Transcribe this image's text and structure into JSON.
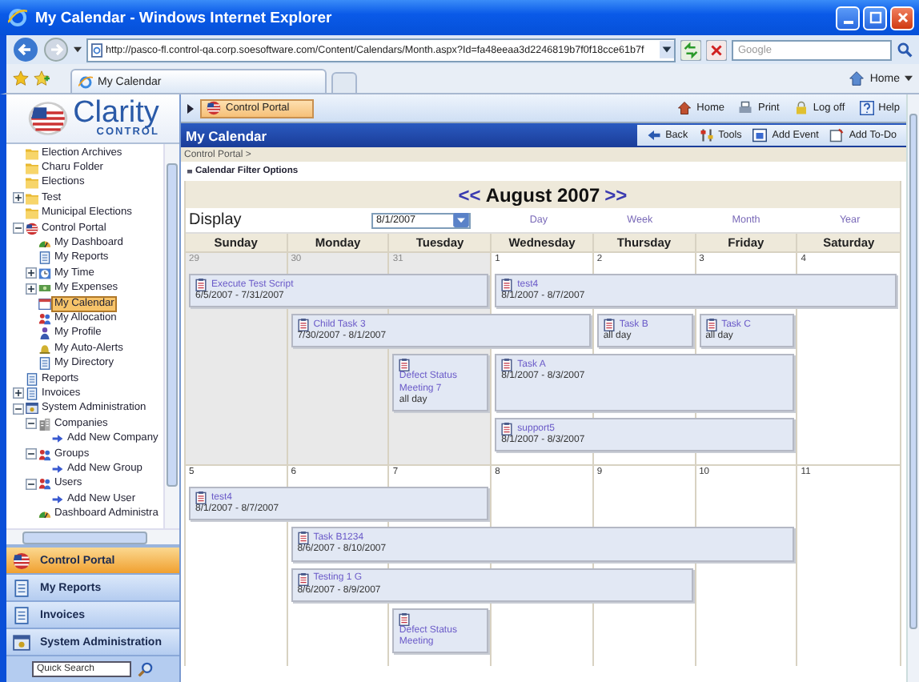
{
  "window": {
    "title": "My Calendar - Windows Internet Explorer"
  },
  "browser": {
    "address": "http://pasco-fl.control-qa.corp.soesoftware.com/Content/Calendars/Month.aspx?Id=fa48eeaa3d2246819b7f0f18cce61b7f",
    "search_placeholder": "Google",
    "tab": "My Calendar",
    "home": "Home"
  },
  "app": {
    "logo_title": "Clarity",
    "logo_subtitle": "CONTROL",
    "portal_button": "Control Portal",
    "top_links": [
      {
        "label": "Home",
        "kind": "home"
      },
      {
        "label": "Print",
        "kind": "print"
      },
      {
        "label": "Log off",
        "kind": "lock"
      },
      {
        "label": "Help",
        "kind": "help"
      }
    ],
    "page_title": "My Calendar",
    "actions": [
      {
        "label": "Back",
        "kind": "back"
      },
      {
        "label": "Tools",
        "kind": "tools"
      },
      {
        "label": "Add Event",
        "kind": "event"
      },
      {
        "label": "Add To-Do",
        "kind": "todo"
      }
    ],
    "breadcrumb": "Control Portal >"
  },
  "tree": [
    {
      "label": "Election Archives",
      "kind": "folder",
      "selected": false
    },
    {
      "label": "Charu Folder",
      "kind": "folder",
      "selected": false
    },
    {
      "label": "Elections",
      "kind": "folder",
      "selected": false
    },
    {
      "label": "Test",
      "kind": "folder",
      "selected": false,
      "expanded": false
    },
    {
      "label": "Municipal Elections",
      "kind": "folder",
      "selected": false
    },
    {
      "label": "Control Portal",
      "kind": "globe",
      "selected": false,
      "expanded": true,
      "children": [
        {
          "label": "My Dashboard",
          "kind": "chart",
          "selected": false
        },
        {
          "label": "My Reports",
          "kind": "page",
          "selected": false
        },
        {
          "label": "My Time",
          "kind": "clock",
          "selected": false,
          "expanded": false
        },
        {
          "label": "My Expenses",
          "kind": "money",
          "selected": false,
          "expanded": false
        },
        {
          "label": "My Calendar",
          "kind": "calendar",
          "selected": true
        },
        {
          "label": "My Allocation",
          "kind": "people",
          "selected": false
        },
        {
          "label": "My Profile",
          "kind": "person",
          "selected": false
        },
        {
          "label": "My Auto-Alerts",
          "kind": "bell",
          "selected": false
        },
        {
          "label": "My Directory",
          "kind": "page",
          "selected": false
        }
      ]
    },
    {
      "label": "Reports",
      "kind": "page",
      "selected": false
    },
    {
      "label": "Invoices",
      "kind": "page",
      "selected": false,
      "expanded": false
    },
    {
      "label": "System Administration",
      "kind": "window",
      "selected": false,
      "expanded": true,
      "children": [
        {
          "label": "Companies",
          "kind": "building",
          "selected": false,
          "expanded": true,
          "children": [
            {
              "label": "Add New Company",
              "kind": "arrow",
              "selected": false
            }
          ]
        },
        {
          "label": "Groups",
          "kind": "people",
          "selected": false,
          "expanded": true,
          "children": [
            {
              "label": "Add New Group",
              "kind": "arrow",
              "selected": false
            }
          ]
        },
        {
          "label": "Users",
          "kind": "people",
          "selected": false,
          "expanded": true,
          "children": [
            {
              "label": "Add New User",
              "kind": "arrow",
              "selected": false
            }
          ]
        },
        {
          "label": "Dashboard Administra",
          "kind": "chart",
          "selected": false
        }
      ]
    }
  ],
  "nav": [
    {
      "label": "Control Portal",
      "kind": "globe",
      "selected": true
    },
    {
      "label": "My Reports",
      "kind": "page",
      "selected": false
    },
    {
      "label": "Invoices",
      "kind": "page",
      "selected": false
    },
    {
      "label": "System Administration",
      "kind": "window",
      "selected": false
    }
  ],
  "quick_search": {
    "placeholder": "Quick Search"
  },
  "calendar": {
    "filter_label": "Calendar Filter Options",
    "prev": "<<",
    "month": "August 2007",
    "next": ">>",
    "display_label": "Display",
    "date": "8/1/2007",
    "views": [
      "Day",
      "Week",
      "Month",
      "Year"
    ],
    "weekdays": [
      "Sunday",
      "Monday",
      "Tuesday",
      "Wednesday",
      "Thursday",
      "Friday",
      "Saturday"
    ],
    "weeks": [
      {
        "days": [
          {
            "number": "29",
            "outside_month": true
          },
          {
            "number": "30",
            "outside_month": true
          },
          {
            "number": "31",
            "outside_month": true
          },
          {
            "number": "1",
            "outside_month": false
          },
          {
            "number": "2",
            "outside_month": false
          },
          {
            "number": "3",
            "outside_month": false
          },
          {
            "number": "4",
            "outside_month": false
          }
        ],
        "lanes": [
          [
            {
              "kind": "event",
              "title": "Execute Test Script",
              "when": "6/5/2007 - 7/31/2007"
            },
            {
              "kind": "continued"
            },
            {
              "kind": "continued"
            },
            {
              "kind": "event",
              "title": "test4",
              "when": "8/1/2007 - 8/7/2007"
            },
            {
              "kind": "continued"
            },
            {
              "kind": "continued"
            },
            {
              "kind": "continued"
            }
          ],
          [
            {
              "kind": "empty"
            },
            {
              "kind": "event",
              "title": "Child Task 3",
              "when": "7/30/2007 - 8/1/2007"
            },
            {
              "kind": "continued"
            },
            {
              "kind": "continued"
            },
            {
              "kind": "event",
              "title": "Task B",
              "when": "all day"
            },
            {
              "kind": "event",
              "title": "Task C",
              "when": "all day"
            },
            {
              "kind": "empty"
            }
          ],
          [
            {
              "kind": "empty"
            },
            {
              "kind": "empty"
            },
            {
              "kind": "event",
              "title": "Defect Status Meeting 7",
              "when": "all day"
            },
            {
              "kind": "event",
              "title": "Task A",
              "when": "8/1/2007 - 8/3/2007"
            },
            {
              "kind": "continued"
            },
            {
              "kind": "continued"
            },
            {
              "kind": "empty"
            }
          ],
          [
            {
              "kind": "empty"
            },
            {
              "kind": "empty"
            },
            {
              "kind": "empty"
            },
            {
              "kind": "event",
              "title": "support5",
              "when": "8/1/2007 - 8/3/2007"
            },
            {
              "kind": "continued"
            },
            {
              "kind": "continued"
            },
            {
              "kind": "empty"
            }
          ]
        ]
      },
      {
        "days": [
          {
            "number": "5",
            "outside_month": false
          },
          {
            "number": "6",
            "outside_month": false
          },
          {
            "number": "7",
            "outside_month": false
          },
          {
            "number": "8",
            "outside_month": false
          },
          {
            "number": "9",
            "outside_month": false
          },
          {
            "number": "10",
            "outside_month": false
          },
          {
            "number": "11",
            "outside_month": false
          }
        ],
        "lanes": [
          [
            {
              "kind": "event",
              "title": "test4",
              "when": "8/1/2007 - 8/7/2007"
            },
            {
              "kind": "continued"
            },
            {
              "kind": "continued"
            },
            {
              "kind": "empty"
            },
            {
              "kind": "empty"
            },
            {
              "kind": "empty"
            },
            {
              "kind": "empty"
            }
          ],
          [
            {
              "kind": "empty"
            },
            {
              "kind": "event",
              "title": "Task B1234",
              "when": "8/6/2007 - 8/10/2007"
            },
            {
              "kind": "continued"
            },
            {
              "kind": "continued"
            },
            {
              "kind": "continued"
            },
            {
              "kind": "continued"
            },
            {
              "kind": "empty"
            }
          ],
          [
            {
              "kind": "empty"
            },
            {
              "kind": "event",
              "title": "Testing 1 G",
              "when": "8/6/2007 - 8/9/2007"
            },
            {
              "kind": "continued"
            },
            {
              "kind": "continued"
            },
            {
              "kind": "continued"
            },
            {
              "kind": "empty"
            },
            {
              "kind": "empty"
            }
          ],
          [
            {
              "kind": "empty"
            },
            {
              "kind": "empty"
            },
            {
              "kind": "event",
              "title": "Defect Status Meeting"
            },
            {
              "kind": "empty"
            },
            {
              "kind": "empty"
            },
            {
              "kind": "empty"
            },
            {
              "kind": "empty"
            }
          ]
        ]
      }
    ]
  }
}
